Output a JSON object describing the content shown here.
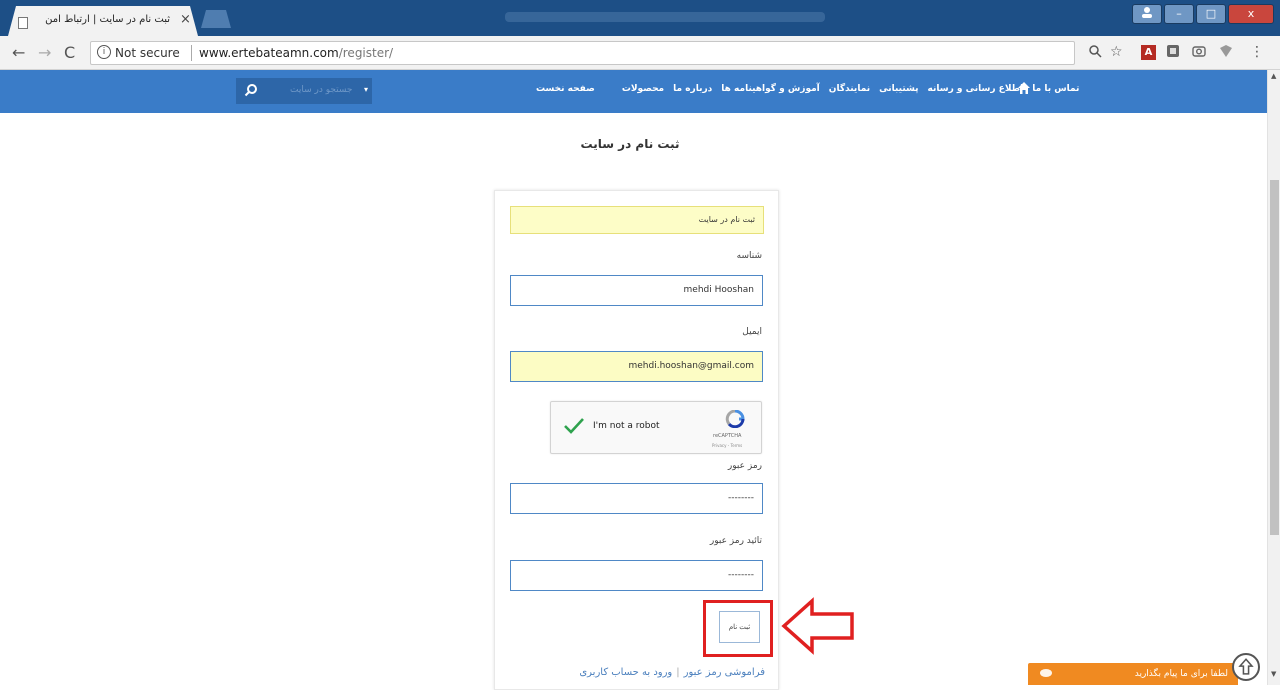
{
  "browser": {
    "tab_title": "ثبت نام در سایت | ارتباط امن",
    "tab_close": "×",
    "security_label": "Not secure",
    "url_host": "www.ertebateamn.com",
    "url_path": "/register/",
    "window_controls": {
      "minimize": "–",
      "maximize": "□",
      "close": "x"
    },
    "icons": {
      "back": "back-arrow-icon",
      "forward": "forward-arrow-icon",
      "reload": "reload-icon",
      "info": "info-icon",
      "zoom": "zoom-icon",
      "bookmark": "star-icon",
      "pdf": "pdf-extension-icon",
      "menu": "kebab-menu-icon"
    }
  },
  "nav": {
    "items": [
      "صفحه نخست",
      "محصولات",
      "درباره ما",
      "آموزش و گواهینامه ها",
      "نمایندگان",
      "پشتیبانی",
      "اطلاع رسانی و رسانه",
      "تماس با ما"
    ],
    "search_placeholder": "جستجو در سایت",
    "search_caret": "▾",
    "accent": "#3a7cc8"
  },
  "page": {
    "title": "ثبت نام در سایت"
  },
  "form": {
    "notice": "ثبت نام در سایت",
    "username_label": "شناسه",
    "username_value": "mehdi Hooshan",
    "email_label": "ایمیل",
    "email_value": "mehdi.hooshan@gmail.com",
    "captcha": {
      "label": "I'm not a robot",
      "brand": "reCAPTCHA",
      "terms": "Privacy - Terms"
    },
    "password_label": "رمز عبور",
    "password_value": "--------",
    "confirm_label": "تائید رمز عبور",
    "confirm_value": "--------",
    "submit_label": "ثبت نام"
  },
  "links": {
    "forgot_password": "فراموشی رمز عبور",
    "login": "ورود به حساب کاربری"
  },
  "chat": {
    "label": "لطفا برای ما پیام بگذارید",
    "color": "#f08a21"
  },
  "annotation": {
    "highlight_color": "#e02020"
  }
}
